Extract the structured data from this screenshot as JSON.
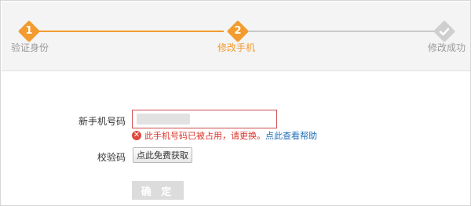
{
  "steps": [
    {
      "number": "1",
      "label": "验证身份",
      "state": "done"
    },
    {
      "number": "2",
      "label": "修改手机",
      "state": "current"
    },
    {
      "icon": "check-icon",
      "label": "修改成功",
      "state": "pending"
    }
  ],
  "colors": {
    "accent": "#f29b2e",
    "inactive": "#cfcfcf",
    "error": "#d9342b",
    "link": "#1d6fb8"
  },
  "form": {
    "phone_label": "新手机号码",
    "phone_value": "",
    "error_text": "此手机号码已被占用，请更换。",
    "help_link": "点此查看帮助",
    "code_label": "校验码",
    "get_code_button": "点此免费获取",
    "confirm_button": "确 定"
  }
}
